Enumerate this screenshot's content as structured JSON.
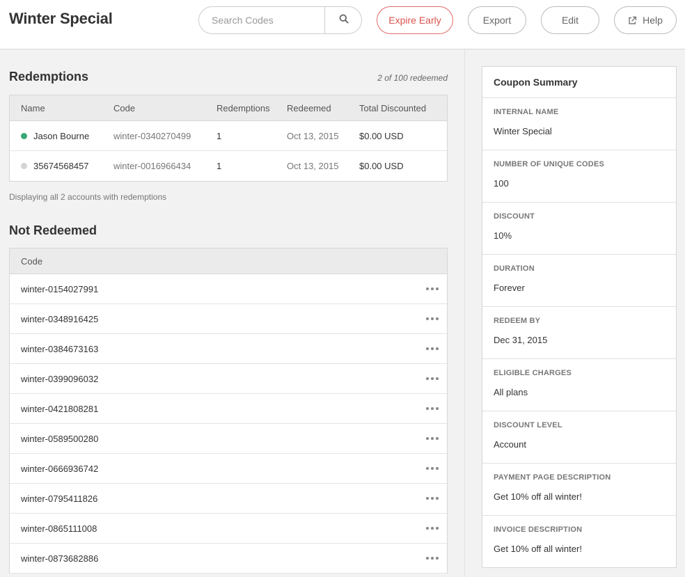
{
  "header": {
    "title": "Winter Special",
    "search_placeholder": "Search Codes",
    "buttons": {
      "expire_early": "Expire Early",
      "export": "Export",
      "edit": "Edit",
      "help": "Help"
    }
  },
  "redemptions": {
    "title": "Redemptions",
    "count_text": "2 of 100 redeemed",
    "columns": [
      "Name",
      "Code",
      "Redemptions",
      "Redeemed",
      "Total Discounted"
    ],
    "rows": [
      {
        "name": "Jason Bourne",
        "status_color": "#3aa776",
        "code": "winter-0340270499",
        "redemptions": "1",
        "redeemed": "Oct 13, 2015",
        "total": "$0.00 USD"
      },
      {
        "name": "35674568457",
        "status_color": "#d4d4d4",
        "code": "winter-0016966434",
        "redemptions": "1",
        "redeemed": "Oct 13, 2015",
        "total": "$0.00 USD"
      }
    ],
    "footer_note": "Displaying all 2 accounts with redemptions"
  },
  "not_redeemed": {
    "title": "Not Redeemed",
    "column": "Code",
    "codes": [
      "winter-0154027991",
      "winter-0348916425",
      "winter-0384673163",
      "winter-0399096032",
      "winter-0421808281",
      "winter-0589500280",
      "winter-0666936742",
      "winter-0795411826",
      "winter-0865111008",
      "winter-0873682886"
    ]
  },
  "summary": {
    "title": "Coupon Summary",
    "items": [
      {
        "label": "INTERNAL NAME",
        "value": "Winter Special"
      },
      {
        "label": "NUMBER OF UNIQUE CODES",
        "value": "100"
      },
      {
        "label": "DISCOUNT",
        "value": "10%"
      },
      {
        "label": "DURATION",
        "value": "Forever"
      },
      {
        "label": "REDEEM BY",
        "value": "Dec 31, 2015"
      },
      {
        "label": "ELIGIBLE CHARGES",
        "value": "All plans"
      },
      {
        "label": "DISCOUNT LEVEL",
        "value": "Account"
      },
      {
        "label": "PAYMENT PAGE DESCRIPTION",
        "value": "Get 10% off all winter!"
      },
      {
        "label": "INVOICE DESCRIPTION",
        "value": "Get 10% off all winter!"
      }
    ]
  },
  "icons": {
    "search": "search-icon",
    "help": "external-link-icon",
    "row_menu": "more-horizontal-icon"
  },
  "colors": {
    "accent_danger": "#d9534f",
    "status_active": "#3aa776",
    "status_inactive": "#d4d4d4"
  }
}
